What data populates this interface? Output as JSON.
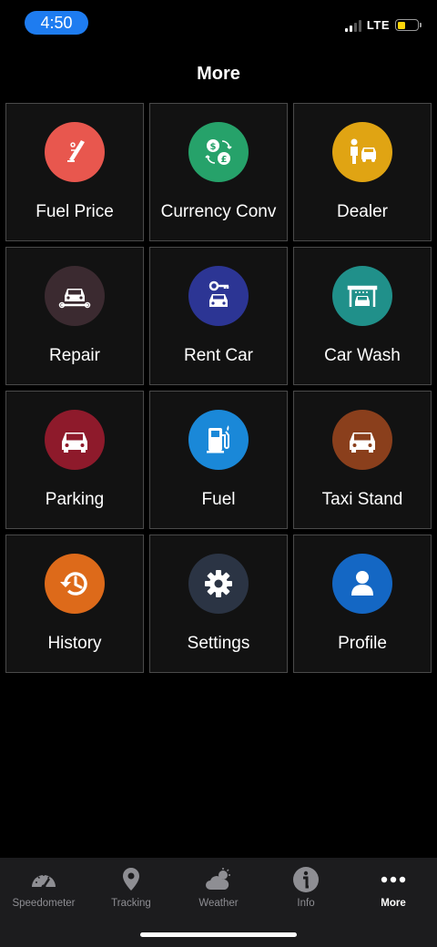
{
  "status": {
    "time": "4:50",
    "network": "LTE"
  },
  "header": {
    "title": "More"
  },
  "tiles": [
    {
      "label": "Fuel Price",
      "icon": "fuel-price-icon",
      "color": "#e8574e"
    },
    {
      "label": "Currency Conv",
      "icon": "currency-exchange-icon",
      "color": "#26a26a"
    },
    {
      "label": "Dealer",
      "icon": "dealer-icon",
      "color": "#e0a413"
    },
    {
      "label": "Repair",
      "icon": "car-repair-icon",
      "color": "#3b2a30"
    },
    {
      "label": "Rent Car",
      "icon": "car-key-icon",
      "color": "#2c3594"
    },
    {
      "label": "Car Wash",
      "icon": "car-wash-icon",
      "color": "#20908a"
    },
    {
      "label": "Parking",
      "icon": "parking-car-icon",
      "color": "#8e1a2b"
    },
    {
      "label": "Fuel",
      "icon": "fuel-pump-icon",
      "color": "#1a88d8"
    },
    {
      "label": "Taxi Stand",
      "icon": "taxi-car-icon",
      "color": "#8a3f1c"
    },
    {
      "label": "History",
      "icon": "history-icon",
      "color": "#dd6a1a"
    },
    {
      "label": "Settings",
      "icon": "gear-icon",
      "color": "#2b3444"
    },
    {
      "label": "Profile",
      "icon": "user-icon",
      "color": "#1467c4"
    }
  ],
  "tabs": [
    {
      "label": "Speedometer",
      "icon": "speedometer-icon",
      "active": false
    },
    {
      "label": "Tracking",
      "icon": "location-pin-icon",
      "active": false
    },
    {
      "label": "Weather",
      "icon": "weather-icon",
      "active": false
    },
    {
      "label": "Info",
      "icon": "info-icon",
      "active": false
    },
    {
      "label": "More",
      "icon": "more-dots-icon",
      "active": true
    }
  ]
}
